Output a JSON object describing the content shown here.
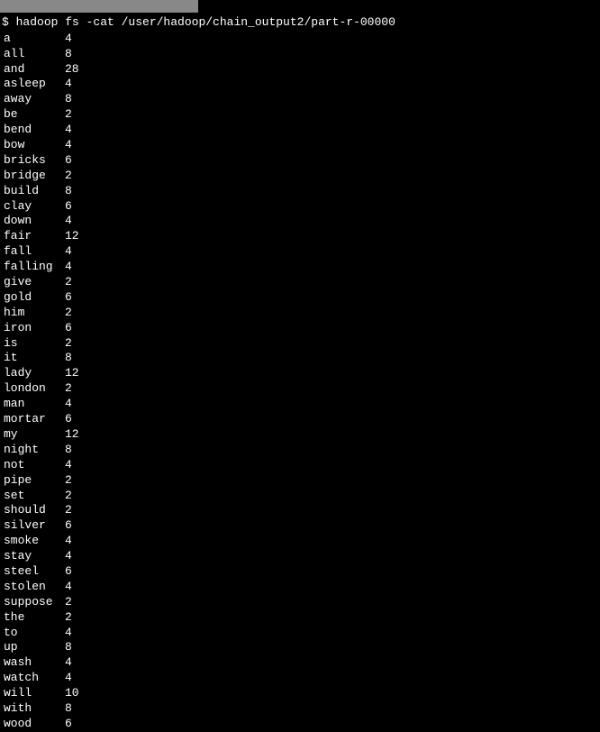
{
  "prompt": "$ ",
  "command": "hadoop fs -cat /user/hadoop/chain_output2/part-r-00000",
  "rows": [
    {
      "word": "a",
      "count": "4"
    },
    {
      "word": "all",
      "count": "8"
    },
    {
      "word": "and",
      "count": "28"
    },
    {
      "word": "asleep",
      "count": "4"
    },
    {
      "word": "away",
      "count": "8"
    },
    {
      "word": "be",
      "count": "2"
    },
    {
      "word": "bend",
      "count": "4"
    },
    {
      "word": "bow",
      "count": "4"
    },
    {
      "word": "bricks",
      "count": "6"
    },
    {
      "word": "bridge",
      "count": "2"
    },
    {
      "word": "build",
      "count": "8"
    },
    {
      "word": "clay",
      "count": "6"
    },
    {
      "word": "down",
      "count": "4"
    },
    {
      "word": "fair",
      "count": "12"
    },
    {
      "word": "fall",
      "count": "4"
    },
    {
      "word": "falling",
      "count": "4"
    },
    {
      "word": "give",
      "count": "2"
    },
    {
      "word": "gold",
      "count": "6"
    },
    {
      "word": "him",
      "count": "2"
    },
    {
      "word": "iron",
      "count": "6"
    },
    {
      "word": "is",
      "count": "2"
    },
    {
      "word": "it",
      "count": "8"
    },
    {
      "word": "lady",
      "count": "12"
    },
    {
      "word": "london",
      "count": "2"
    },
    {
      "word": "man",
      "count": "4"
    },
    {
      "word": "mortar",
      "count": "6"
    },
    {
      "word": "my",
      "count": "12"
    },
    {
      "word": "night",
      "count": "8"
    },
    {
      "word": "not",
      "count": "4"
    },
    {
      "word": "pipe",
      "count": "2"
    },
    {
      "word": "set",
      "count": "2"
    },
    {
      "word": "should",
      "count": "2"
    },
    {
      "word": "silver",
      "count": "6"
    },
    {
      "word": "smoke",
      "count": "4"
    },
    {
      "word": "stay",
      "count": "4"
    },
    {
      "word": "steel",
      "count": "6"
    },
    {
      "word": "stolen",
      "count": "4"
    },
    {
      "word": "suppose",
      "count": "2"
    },
    {
      "word": "the",
      "count": "2"
    },
    {
      "word": "to",
      "count": "4"
    },
    {
      "word": "up",
      "count": "8"
    },
    {
      "word": "wash",
      "count": "4"
    },
    {
      "word": "watch",
      "count": "4"
    },
    {
      "word": "will",
      "count": "10"
    },
    {
      "word": "with",
      "count": "8"
    },
    {
      "word": "wood",
      "count": "6"
    }
  ]
}
